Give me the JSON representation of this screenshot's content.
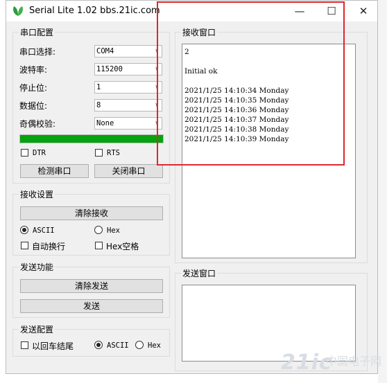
{
  "window": {
    "title": "Serial Lite 1.02 bbs.21ic.com",
    "minimize": "—",
    "maximize": "☐",
    "close": "✕"
  },
  "serial_config": {
    "group_title": "串口配置",
    "port_label": "串口选择:",
    "port_value": "COM4",
    "baud_label": "波特率:",
    "baud_value": "115200",
    "stop_label": "停止位:",
    "stop_value": "1",
    "data_label": "数据位:",
    "data_value": "8",
    "parity_label": "奇偶校验:",
    "parity_value": "None",
    "progress": 1.0,
    "progress_color": "#06a20f",
    "dtr_label": "DTR",
    "rts_label": "RTS",
    "detect_button": "检测串口",
    "close_button": "关闭串口"
  },
  "receive_settings": {
    "group_title": "接收设置",
    "clear_button": "清除接收",
    "ascii_label": "ASCII",
    "hex_label": "Hex",
    "autowrap_label": "自动换行",
    "hexspace_label": "Hex空格"
  },
  "send_function": {
    "group_title": "发送功能",
    "clear_button": "清除发送",
    "send_button": "发送"
  },
  "send_config": {
    "group_title": "发送配置",
    "enter_label": "以回车结尾",
    "ascii_label": "ASCII",
    "hex_label": "Hex"
  },
  "receive_window": {
    "title": "接收窗口",
    "lines": [
      "2",
      "",
      "Initial ok",
      "",
      "2021/1/25 14:10:34 Monday",
      "2021/1/25 14:10:35 Monday",
      "2021/1/25 14:10:36 Monday",
      "2021/1/25 14:10:37 Monday",
      "2021/1/25 14:10:38 Monday",
      "2021/1/25 14:10:39 Monday"
    ]
  },
  "send_window": {
    "title": "发送窗口",
    "content": ""
  },
  "watermark": {
    "brand": "21ic",
    "site": "中国电子网"
  },
  "colors": {
    "highlight": "#e0262c",
    "logo_green": "#2e9a3c"
  }
}
